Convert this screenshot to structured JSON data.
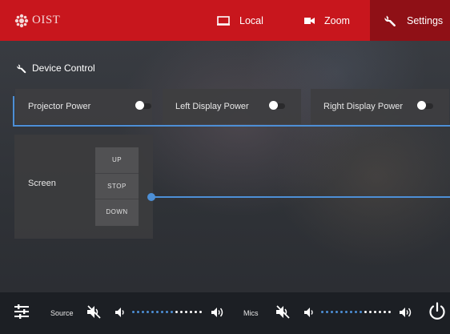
{
  "brand": {
    "logo_text": "OIST"
  },
  "nav": {
    "tabs": [
      {
        "label": "Local",
        "icon": "display-icon"
      },
      {
        "label": "Zoom",
        "icon": "video-camera-icon"
      },
      {
        "label": "Settings",
        "icon": "wrench-icon",
        "active": true
      }
    ]
  },
  "section": {
    "title": "Device Control",
    "icon": "wrench-icon"
  },
  "power": [
    {
      "label": "Projector Power",
      "on": false
    },
    {
      "label": "Left Display Power",
      "on": false
    },
    {
      "label": "Right Display Power",
      "on": false
    }
  ],
  "screen": {
    "label": "Screen",
    "buttons": [
      "UP",
      "STOP",
      "DOWN"
    ]
  },
  "bottom": {
    "source_label": "Source",
    "source_level": 0.6,
    "mics_label": "Mics",
    "mics_level": 0.6,
    "icons": [
      "mixer-icon",
      "mute-icon",
      "volume-down-icon",
      "volume-up-icon",
      "power-icon"
    ]
  },
  "colors": {
    "brand_red": "#c8161d",
    "active_tab": "#8f1016",
    "accent_blue": "#4d8fd6",
    "bottom_bar": "#1c1f24"
  }
}
